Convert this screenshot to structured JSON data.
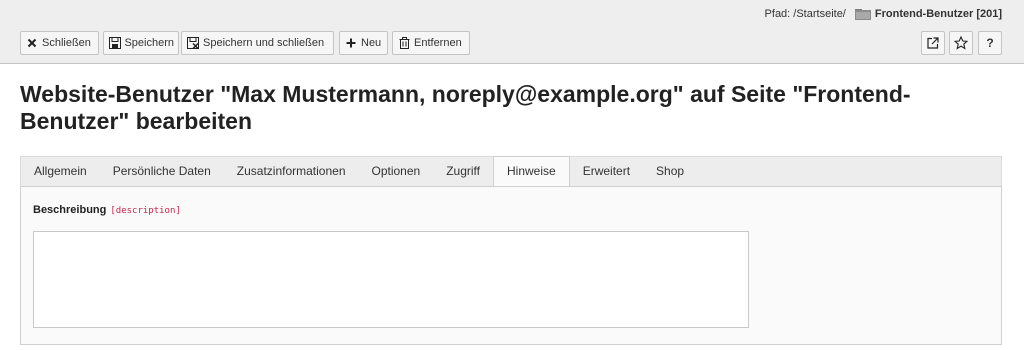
{
  "header": {
    "path_label": "Pfad: /Startseite/",
    "path_title": "Frontend-Benutzer [201]"
  },
  "toolbar": {
    "close_label": "Schließen",
    "save_label": "Speichern",
    "save_close_label": "Speichern und schließen",
    "new_label": "Neu",
    "delete_label": "Entfernen",
    "help_label": "?"
  },
  "icons": {
    "close": "close-icon",
    "save": "save-icon",
    "save_close": "save-close-icon",
    "new": "plus-icon",
    "delete": "trash-icon",
    "open_new_window": "external-link-icon",
    "bookmark": "star-icon",
    "help": "help-icon",
    "folder": "folder-icon"
  },
  "page": {
    "title": "Website-Benutzer \"Max Mustermann, noreply@example.org\" auf Seite \"Frontend-Benutzer\" bearbeiten"
  },
  "tabs": [
    {
      "label": "Allgemein",
      "active": false
    },
    {
      "label": "Persönliche Daten",
      "active": false
    },
    {
      "label": "Zusatzinformationen",
      "active": false
    },
    {
      "label": "Optionen",
      "active": false
    },
    {
      "label": "Zugriff",
      "active": false
    },
    {
      "label": "Hinweise",
      "active": true
    },
    {
      "label": "Erweitert",
      "active": false
    },
    {
      "label": "Shop",
      "active": false
    }
  ],
  "form": {
    "description_label": "Beschreibung",
    "description_key": "[description]",
    "description_value": ""
  },
  "colors": {
    "field_key": "#c7254e",
    "header_bg": "#eeeeee"
  }
}
